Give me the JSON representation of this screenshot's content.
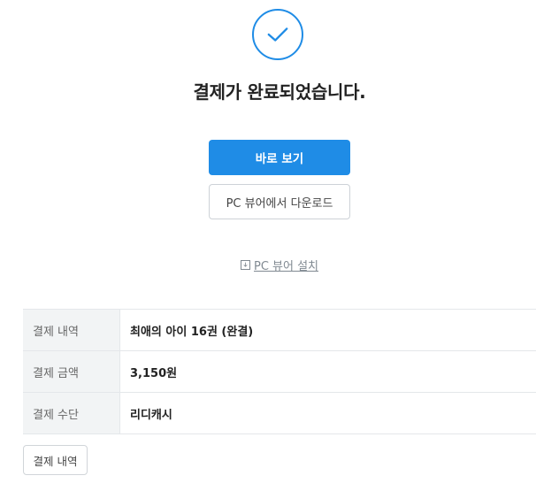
{
  "status": {
    "icon": "check-icon",
    "title": "결제가 완료되었습니다."
  },
  "actions": {
    "view_now_label": "바로 보기",
    "pc_download_label": "PC 뷰어에서 다운로드",
    "install_link_label": "PC 뷰어 설치"
  },
  "details": {
    "rows": [
      {
        "label": "결제 내역",
        "value": "최애의 아이 16권 (완결)"
      },
      {
        "label": "결제 금액",
        "value": "3,150원"
      },
      {
        "label": "결제 수단",
        "value": "리디캐시"
      }
    ]
  },
  "footer": {
    "history_button_label": "결제 내역"
  },
  "colors": {
    "accent": "#1f8ce6",
    "muted_text": "#808991",
    "table_header_bg": "#f2f4f5"
  }
}
